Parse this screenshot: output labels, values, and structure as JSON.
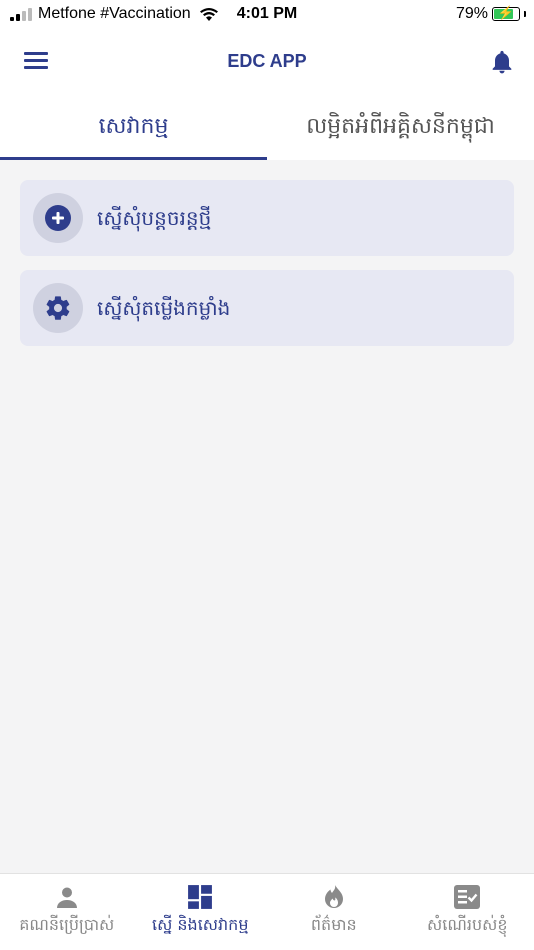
{
  "status_bar": {
    "carrier": "Metfone #Vaccination",
    "time": "4:01 PM",
    "battery_percent": "79%",
    "battery_level": 0.79
  },
  "app_bar": {
    "title": "EDC APP",
    "menu_icon": "hamburger-menu-icon",
    "notification_icon": "bell-icon"
  },
  "tabs": [
    {
      "label": "សេវាកម្ម",
      "active": true
    },
    {
      "label": "លម្អិតអំពីអគ្គិសនីកម្ពុជា",
      "active": false
    }
  ],
  "actions": [
    {
      "label": "ស្នើសុំបន្តចរន្តថ្មី",
      "icon": "plus-circle-icon"
    },
    {
      "label": "ស្នើសុំតម្លើងកម្លាំង",
      "icon": "gear-icon"
    }
  ],
  "bottom_nav": [
    {
      "label": "គណនីប្រើប្រាស់",
      "icon": "person-icon",
      "active": false
    },
    {
      "label": "ស្នើ និងសេវាកម្ម",
      "icon": "dashboard-icon",
      "active": true
    },
    {
      "label": "ព័ត៌មាន",
      "icon": "flame-icon",
      "active": false
    },
    {
      "label": "សំណើរបស់ខ្ញុំ",
      "icon": "checklist-icon",
      "active": false
    }
  ],
  "colors": {
    "primary": "#2e3d8c",
    "card_bg": "#e7e8f3",
    "battery": "#34c759"
  }
}
